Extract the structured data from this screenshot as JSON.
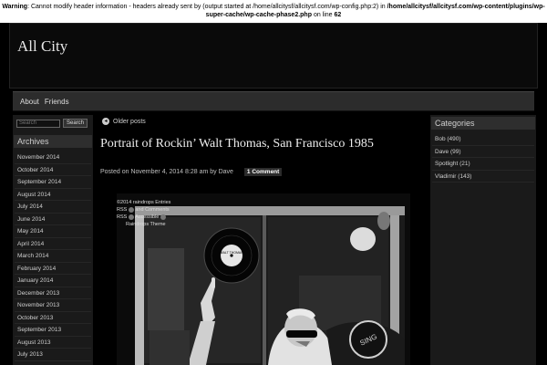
{
  "warning": {
    "label": "Warning",
    "message": ": Cannot modify header information - headers already sent by (output started at /home/allcitysf/allcitysf.com/wp-config.php:2) in ",
    "path": "/home/allcitysf/allcitysf.com/wp-content/plugins/wp-super-cache/wp-cache-phase2.php",
    "on_line": " on line ",
    "line_number": "62"
  },
  "site": {
    "title": "All City"
  },
  "nav": {
    "items": [
      "About",
      "Friends"
    ]
  },
  "search": {
    "placeholder": "Search",
    "button_label": "Search"
  },
  "archives": {
    "heading": "Archives",
    "items": [
      "November 2014",
      "October 2014",
      "September 2014",
      "August 2014",
      "July 2014",
      "June 2014",
      "May 2014",
      "April 2014",
      "March 2014",
      "February 2014",
      "January 2014",
      "December 2013",
      "November 2013",
      "October 2013",
      "September 2013",
      "August 2013",
      "July 2013"
    ]
  },
  "post": {
    "older_posts_label": "Older posts",
    "title": "Portrait of Rockin’ Walt Thomas, San Francisco 1985",
    "meta": "Posted on November 4, 2014 8:28 am by Dave",
    "comments_label": "1 Comment",
    "credit": {
      "line1": "©2014  raindrops  Entries",
      "line2a": "RSS",
      "line2b": "and Comments",
      "line3a": "RSS",
      "line3b": "Accessible",
      "line4": "Raindrops Theme"
    },
    "record_label": "WALT THOMAS",
    "shirt_text": "SING"
  },
  "categories": {
    "heading": "Categories",
    "items": [
      "Bob (490)",
      "Dave (99)",
      "Spotlight (21)",
      "Vladimir (143)"
    ]
  },
  "icons": {
    "older": "circle-arrow-left-icon",
    "credit": "rss-icon"
  }
}
